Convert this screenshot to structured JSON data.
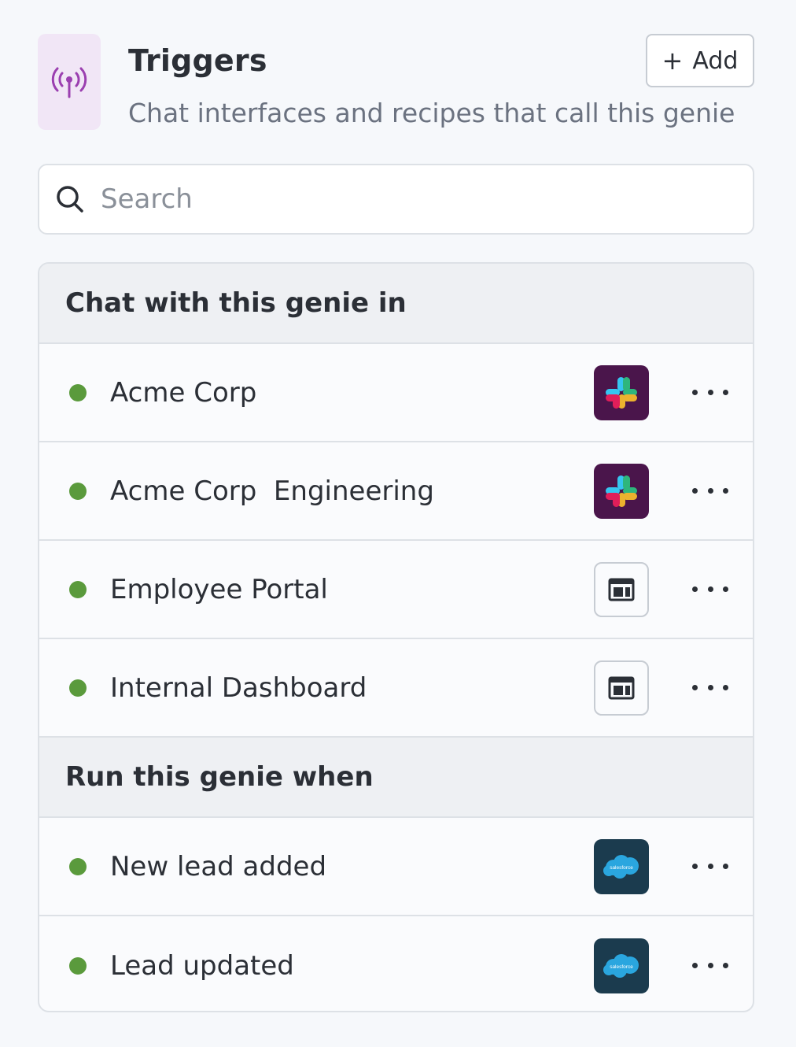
{
  "header": {
    "icon": "broadcast-antenna-icon",
    "accent": "#9b3fb0",
    "title": "Triggers",
    "subtitle": "Chat interfaces and recipes that call this genie",
    "add_label": "Add"
  },
  "search": {
    "placeholder": "Search",
    "value": ""
  },
  "sections": [
    {
      "title": "Chat with this genie in",
      "items": [
        {
          "label": "Acme Corp",
          "status": "active",
          "app_icon": "slack-icon"
        },
        {
          "label": "Acme Corp  Engineering",
          "status": "active",
          "app_icon": "slack-icon"
        },
        {
          "label": "Employee Portal",
          "status": "active",
          "app_icon": "web-page-icon"
        },
        {
          "label": "Internal Dashboard",
          "status": "active",
          "app_icon": "web-page-icon"
        }
      ]
    },
    {
      "title": "Run this genie when",
      "items": [
        {
          "label": "New lead added",
          "status": "active",
          "app_icon": "salesforce-icon",
          "app_icon_text": "salesforce"
        },
        {
          "label": "Lead updated",
          "status": "active",
          "app_icon": "salesforce-icon",
          "app_icon_text": "salesforce"
        }
      ]
    }
  ],
  "colors": {
    "status_active": "#5a9a3c",
    "slack_bg": "#4a154b",
    "salesforce_bg": "#1b3b4e",
    "salesforce_cloud": "#2aa6df"
  }
}
